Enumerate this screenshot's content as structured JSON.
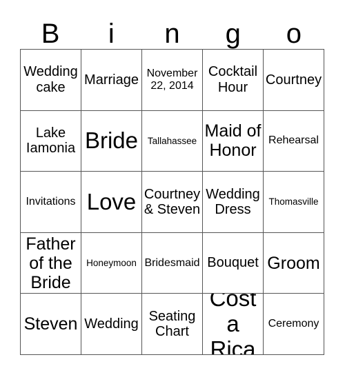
{
  "card": {
    "title": "Bingo",
    "header_letters": [
      "B",
      "i",
      "n",
      "g",
      "o"
    ],
    "grid_size": "5x5",
    "line_color": "#555555",
    "text_color": "#000000",
    "background_color": "#ffffff"
  },
  "grid": {
    "rows": [
      [
        {
          "label": "Wedding cake",
          "size": "md"
        },
        {
          "label": "Marriage",
          "size": "md"
        },
        {
          "label": "November 22, 2014",
          "size": "sm"
        },
        {
          "label": "Cocktail Hour",
          "size": "md"
        },
        {
          "label": "Courtney",
          "size": "md"
        }
      ],
      [
        {
          "label": "Lake Iamonia",
          "size": "md"
        },
        {
          "label": "Bride",
          "size": "xl"
        },
        {
          "label": "Tallahassee",
          "size": "xs"
        },
        {
          "label": "Maid of Honor",
          "size": "lg"
        },
        {
          "label": "Rehearsal",
          "size": "sm"
        }
      ],
      [
        {
          "label": "Invitations",
          "size": "sm"
        },
        {
          "label": "Love",
          "size": "xl"
        },
        {
          "label": "Courtney & Steven",
          "size": "md"
        },
        {
          "label": "Wedding Dress",
          "size": "md"
        },
        {
          "label": "Thomasville",
          "size": "xs"
        }
      ],
      [
        {
          "label": "Father of the Bride",
          "size": "lg"
        },
        {
          "label": "Honeymoon",
          "size": "xs"
        },
        {
          "label": "Bridesmaid",
          "size": "sm"
        },
        {
          "label": "Bouquet",
          "size": "md"
        },
        {
          "label": "Groom",
          "size": "lg"
        }
      ],
      [
        {
          "label": "Steven",
          "size": "lg"
        },
        {
          "label": "Wedding",
          "size": "md"
        },
        {
          "label": "Seating Chart",
          "size": "md"
        },
        {
          "label": "Costa Rica",
          "size": "xl"
        },
        {
          "label": "Ceremony",
          "size": "sm"
        }
      ]
    ]
  }
}
